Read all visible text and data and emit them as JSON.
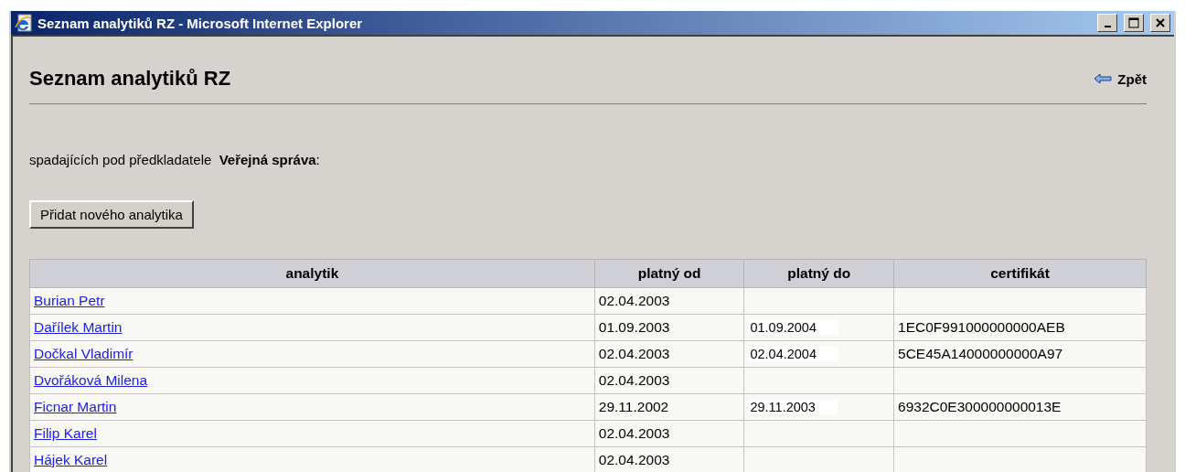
{
  "window": {
    "title": "Seznam analytiků RZ - Microsoft Internet Explorer"
  },
  "page": {
    "heading": "Seznam analytiků RZ",
    "back_link": "Zpět",
    "intro": "spadajících pod předkladatele  **Veřejná správa**:",
    "add_button": "Přidat nového analytika"
  },
  "table": {
    "columns": [
      "analytik",
      "platný od",
      "platný do",
      "certifikát"
    ],
    "rows": [
      {
        "analytik": "Burian Petr",
        "platny_od": "02.04.2003"
      },
      {
        "analytik": "Dařílek Martin",
        "platny_od": "01.09.2003",
        "platny_do": "01.09.2004",
        "certifikat": "1EC0F991000000000AEB"
      },
      {
        "analytik": "Dočkal Vladimír",
        "platny_od": "02.04.2003",
        "platny_do": "02.04.2004",
        "certifikat": "5CE45A14000000000A97"
      },
      {
        "analytik": "Dvořáková Milena",
        "platny_od": "02.04.2003"
      },
      {
        "analytik": "Ficnar Martin",
        "platny_od": "29.11.2002",
        "platny_do": "29.11.2003",
        "certifikat": "6932C0E300000000013E"
      },
      {
        "analytik": "Filip Karel",
        "platny_od": "02.04.2003"
      },
      {
        "analytik": "Hájek Karel",
        "platny_od": "02.04.2003"
      }
    ]
  }
}
